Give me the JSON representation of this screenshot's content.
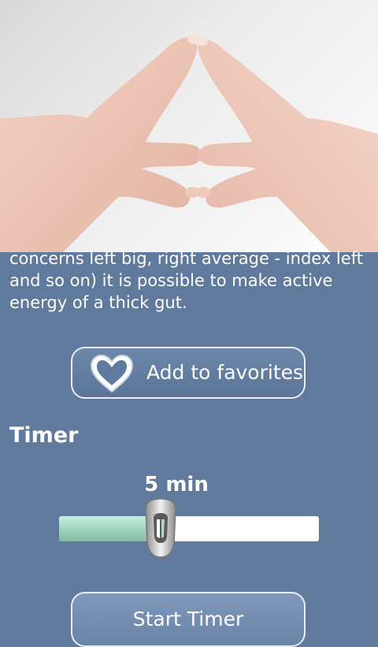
{
  "hero": {
    "image": "hands-mudra-photo"
  },
  "description": {
    "text": "concerns left big, right average - index left and so on) it is possible to make active energy of a thick gut."
  },
  "favorites": {
    "label": "Add to favorites",
    "icon": "heart-outline-icon"
  },
  "timer": {
    "title": "Timer",
    "value_label": "5 min",
    "slider_fraction": 0.39
  },
  "start": {
    "label": "Start Timer"
  },
  "colors": {
    "background": "#607a9e",
    "slider_fill": "#a8dcc6",
    "slider_track": "#ffffff"
  }
}
